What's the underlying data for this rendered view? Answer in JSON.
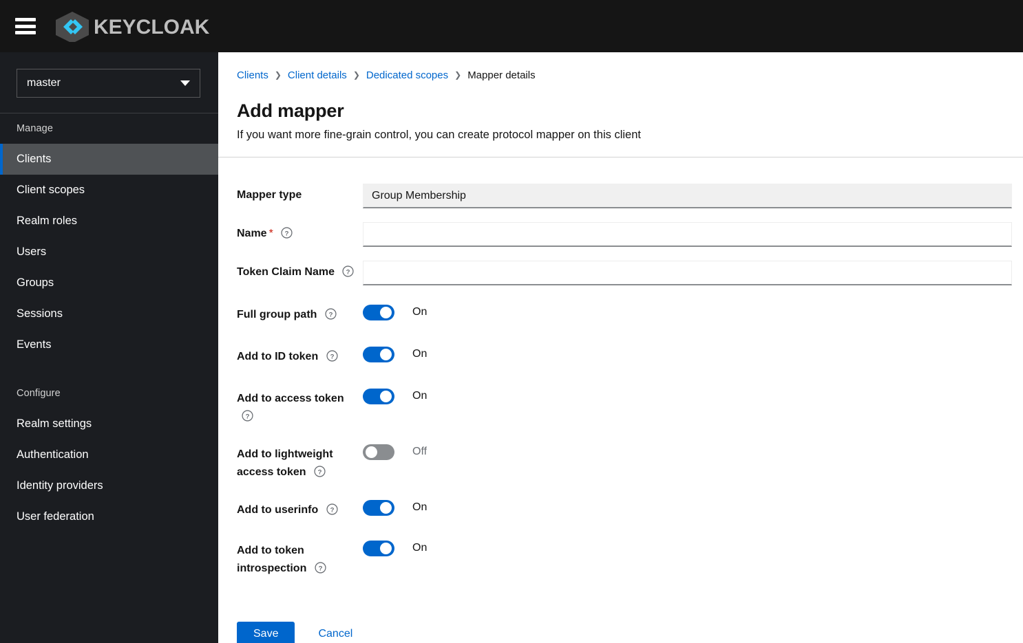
{
  "masthead": {
    "menu_icon": "hamburger-icon",
    "brand_name": "KEYCLOAK",
    "brand_colors": {
      "hex_accent": "#33c6f4",
      "hex_hexagon": "#4a4a4a",
      "hex_text": "#bdbdbd"
    }
  },
  "sidebar": {
    "realm_selector": {
      "value": "master",
      "caret_icon": "chevron-down-icon"
    },
    "sections": [
      {
        "title": "Manage",
        "items": [
          {
            "label": "Clients",
            "active": true
          },
          {
            "label": "Client scopes",
            "active": false
          },
          {
            "label": "Realm roles",
            "active": false
          },
          {
            "label": "Users",
            "active": false
          },
          {
            "label": "Groups",
            "active": false
          },
          {
            "label": "Sessions",
            "active": false
          },
          {
            "label": "Events",
            "active": false
          }
        ]
      },
      {
        "title": "Configure",
        "items": [
          {
            "label": "Realm settings",
            "active": false
          },
          {
            "label": "Authentication",
            "active": false
          },
          {
            "label": "Identity providers",
            "active": false
          },
          {
            "label": "User federation",
            "active": false
          }
        ]
      }
    ],
    "colors": {
      "hex_bg": "#1b1d21",
      "hex_active_bg": "#4f5255",
      "hex_active_bar": "#0066cc"
    }
  },
  "breadcrumb": {
    "separator": "❯",
    "items": [
      {
        "label": "Clients",
        "current": false
      },
      {
        "label": "Client details",
        "current": false
      },
      {
        "label": "Dedicated scopes",
        "current": false
      },
      {
        "label": "Mapper details",
        "current": true
      }
    ]
  },
  "header": {
    "title": "Add mapper",
    "subtitle": "If you want more fine-grain control, you can create protocol mapper on this client"
  },
  "form": {
    "mapper_type": {
      "label": "Mapper type",
      "value": "Group Membership",
      "readonly": true,
      "placeholder": ""
    },
    "name": {
      "label": "Name",
      "required_marker": "*",
      "value": "",
      "placeholder": "",
      "help_icon": "help-circle-icon"
    },
    "token_claim_name": {
      "label": "Token Claim Name",
      "value": "",
      "placeholder": "",
      "help_icon": "help-circle-icon"
    },
    "switches": [
      {
        "label": "Full group path",
        "state_label": "On",
        "on": true,
        "help_icon": "help-circle-icon"
      },
      {
        "label": "Add to ID token",
        "state_label": "On",
        "on": true,
        "help_icon": "help-circle-icon"
      },
      {
        "label": "Add to access token",
        "state_label": "On",
        "on": true,
        "help_icon": "help-circle-icon"
      },
      {
        "label": "Add to lightweight access token",
        "state_label": "Off",
        "on": false,
        "help_icon": "help-circle-icon"
      },
      {
        "label": "Add to userinfo",
        "state_label": "On",
        "on": true,
        "help_icon": "help-circle-icon"
      },
      {
        "label": "Add to token introspection",
        "state_label": "On",
        "on": true,
        "help_icon": "help-circle-icon"
      }
    ]
  },
  "actions": {
    "save_label": "Save",
    "cancel_label": "Cancel",
    "hex_primary": "#0066cc"
  }
}
